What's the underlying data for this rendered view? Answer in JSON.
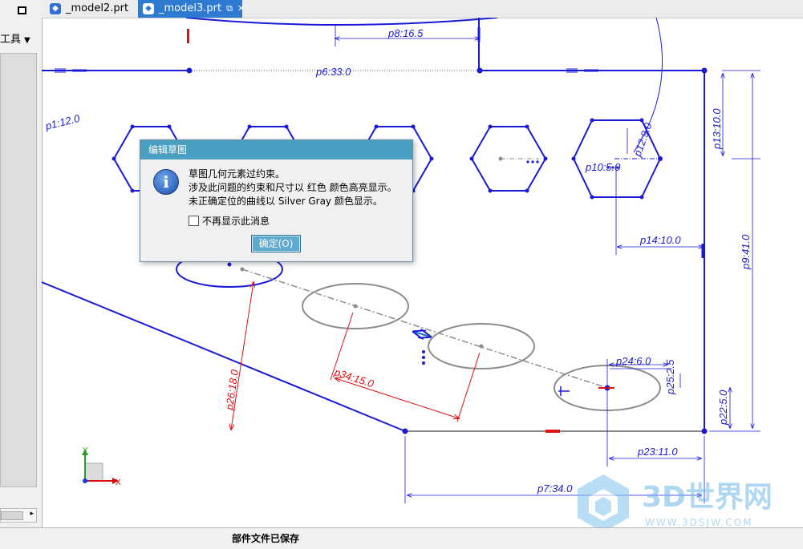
{
  "left_panel": {
    "tools_label": "工具"
  },
  "tabs": [
    {
      "label": "_model2.prt"
    },
    {
      "label": "_model3.prt",
      "active": true
    }
  ],
  "dimensions": {
    "p8": "p8:16.5",
    "p6": "p6:33.0",
    "p1": "p1:12.0",
    "p12": "p12:9.0",
    "p10": "p10:5.0",
    "p13": "p13:10.0",
    "p14": "p14:10.0",
    "p9": "p9:41.0",
    "p24": "p24:6.0",
    "p25": "p25:2.5",
    "p34": "p34:15.0",
    "p26": "p26:18.0",
    "p22": "p22:5.0",
    "p23": "p23:11.0",
    "p7": "p7:34.0"
  },
  "dialog": {
    "title": "编辑草图",
    "line1": "草图几何元素过约束。",
    "line2": "涉及此问题的约束和尺寸以 红色 颜色高亮显示。",
    "line3": "未正确定位的曲线以 Silver Gray 颜色显示。",
    "checkbox_label": "不再显示此消息",
    "ok_label": "确定(O)"
  },
  "triad": {
    "x": "X",
    "y": "Y"
  },
  "status": {
    "text": "部件文件已保存"
  },
  "watermark": {
    "brand": "3D世界网",
    "url": "WWW.3DSJW.COM"
  },
  "colors": {
    "sketch": "#1a1ad6",
    "conflict": "#e01010",
    "silver": "#8c8c8c",
    "dialog_title": "#4a9ebf"
  }
}
